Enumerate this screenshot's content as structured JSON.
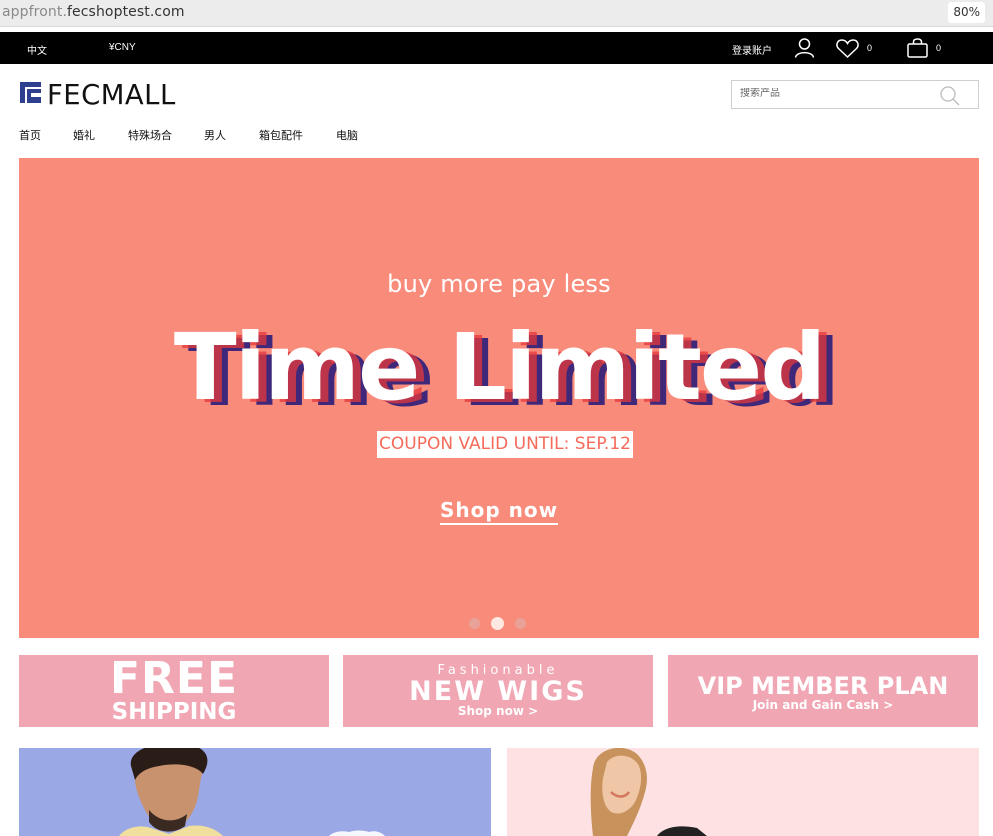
{
  "browser": {
    "url_scheme": "appfront.",
    "url_host": "fecshoptest.com",
    "zoom": "80%"
  },
  "topbar": {
    "language": "中文",
    "currency": "¥CNY",
    "login": "登录账户",
    "wishlist_count": "0",
    "cart_count": "0"
  },
  "header": {
    "logo_text": "FECMALL",
    "search_placeholder": "搜索产品"
  },
  "nav": {
    "items": [
      {
        "label": "首页"
      },
      {
        "label": "婚礼"
      },
      {
        "label": "特殊场合"
      },
      {
        "label": "男人"
      },
      {
        "label": "箱包配件"
      },
      {
        "label": "电脑"
      }
    ]
  },
  "hero": {
    "subtitle": "buy more pay less",
    "title": "Time Limited",
    "coupon": "COUPON VALID UNTIL: SEP.12",
    "cta": "Shop now",
    "slide_count": 3,
    "active_slide": 2
  },
  "promos": {
    "free": {
      "line1": "FREE",
      "line2": "SHIPPING"
    },
    "wigs": {
      "line1": "Fashionable",
      "line2": "NEW WIGS",
      "line3": "Shop now >"
    },
    "vip": {
      "line1": "VIP MEMBER PLAN",
      "line2": "Join and Gain Cash >"
    }
  },
  "colors": {
    "hero_bg": "#f98b7b",
    "tile_bg": "#f0a6b3",
    "banner_left_bg": "#9aa9e6",
    "banner_right_bg": "#fde1e3",
    "logo_accent": "#2f3f8f"
  }
}
